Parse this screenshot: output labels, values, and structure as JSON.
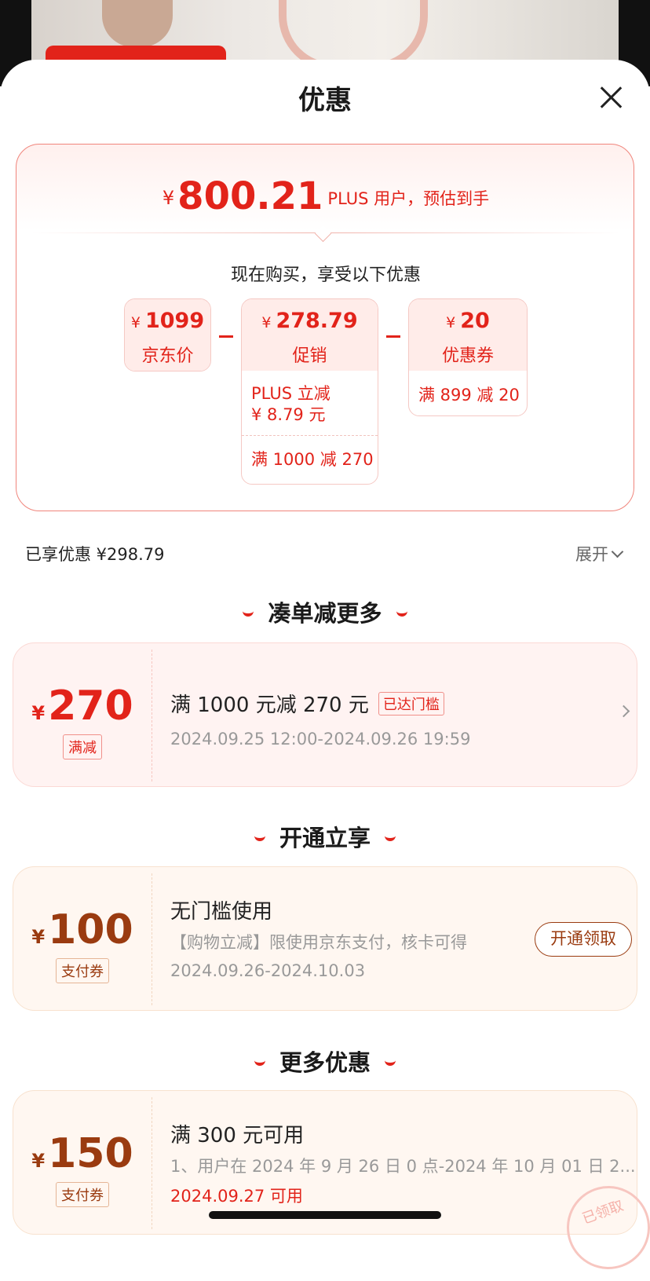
{
  "sheet": {
    "title": "优惠"
  },
  "estimate": {
    "currency": "¥",
    "amount": "800.21",
    "note": "PLUS 用户，预估到手"
  },
  "breakdown": {
    "heading": "现在购买，享受以下优惠",
    "jd_price": {
      "currency": "¥",
      "value": "1099",
      "label": "京东价"
    },
    "promotion": {
      "currency": "¥",
      "value": "278.79",
      "label": "促销",
      "lines": [
        "PLUS 立减\n¥ 8.79 元",
        "满 1000 减 270"
      ]
    },
    "coupon": {
      "currency": "¥",
      "value": "20",
      "label": "优惠券",
      "lines": [
        "满 899 减 20"
      ]
    }
  },
  "enjoyed": {
    "text": "已享优惠 ¥298.79",
    "expand_label": "展开"
  },
  "sections": {
    "bundle": {
      "title": "凑单减更多"
    },
    "open": {
      "title": "开通立享"
    },
    "more": {
      "title": "更多优惠"
    }
  },
  "coupons": {
    "c1": {
      "currency": "¥",
      "amount": "270",
      "tag": "满减",
      "title": "满 1000 元减 270 元",
      "badge": "已达门槛",
      "period": "2024.09.25 12:00-2024.09.26 19:59"
    },
    "c2": {
      "currency": "¥",
      "amount": "100",
      "tag": "支付券",
      "title": "无门槛使用",
      "desc": "【购物立减】限使用京东支付，核卡可得",
      "period": "2024.09.26-2024.10.03",
      "button": "开通领取"
    },
    "c3": {
      "currency": "¥",
      "amount": "150",
      "tag": "支付券",
      "title": "满 300 元可用",
      "desc": "1、用户在 2024 年 9 月 26 日 0 点-2024 年 10 月 01 日 2...",
      "period": "2024.09.27 可用",
      "stamp": "已领取"
    }
  },
  "colors": {
    "accent": "#e2231a",
    "gold": "#9a3b10"
  }
}
